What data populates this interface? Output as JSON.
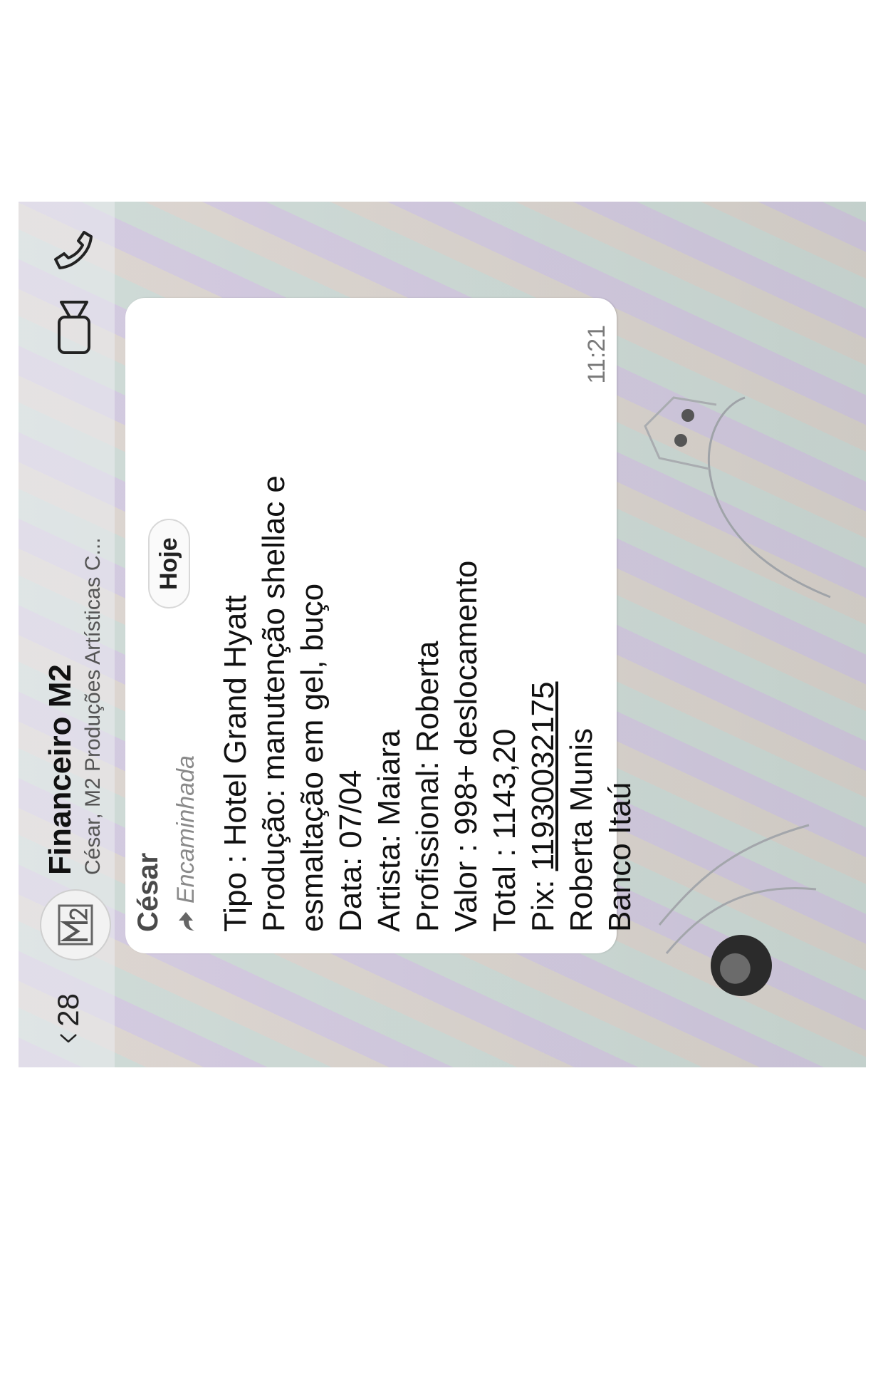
{
  "header": {
    "back_count": "28",
    "title": "Financeiro M2",
    "subtitle": "César, M2 Produções Artísticas C...",
    "avatar_logo": "M2",
    "icons": [
      "chevron-left-icon",
      "video-call-icon",
      "phone-call-icon"
    ]
  },
  "chat": {
    "date_label": "Hoje",
    "message": {
      "sender": "César",
      "forwarded_label": "Encaminhada",
      "lines": [
        "Tipo : Hotel Grand Hyatt",
        "Produção: manutenção shellac e",
        "esmaltação em gel, buço",
        "Data: 07/04",
        "Artista: Maiara",
        "Profissional: Roberta",
        "Valor : 998+ deslocamento",
        "Total : 1143,20"
      ],
      "pix_label": "Pix: ",
      "pix_number": "11930032175",
      "lines_after": [
        "Roberta Munis",
        "Banco Itaú"
      ],
      "time": "11:21"
    }
  },
  "colors": {
    "bubble": "#ffffff",
    "text": "#111111",
    "muted": "#7a7a7a"
  }
}
